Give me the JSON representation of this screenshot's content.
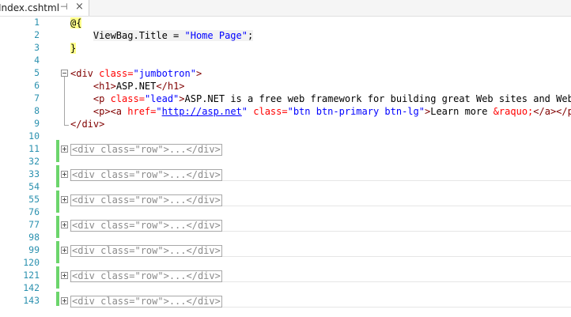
{
  "tab": {
    "title": "Index.cshtml",
    "pin_glyph": "⊣",
    "close_glyph": "×",
    "pin_icon": "pin-icon",
    "close_icon": "close-icon"
  },
  "gutter": {
    "line_numbers": [
      "1",
      "2",
      "3",
      "4",
      "5",
      "6",
      "7",
      "8",
      "9",
      "10",
      "11",
      "32",
      "33",
      "54",
      "55",
      "76",
      "77",
      "98",
      "99",
      "120",
      "121",
      "142",
      "143"
    ]
  },
  "code": {
    "razor_open": "@{",
    "viewbag_text": "ViewBag.Title = ",
    "viewbag_value": "\"Home Page\"",
    "viewbag_end": ";",
    "razor_close": "}",
    "div_open": "<div",
    "class_attr": " class=",
    "jumbotron_value": "\"jumbotron\"",
    "tag_close": ">",
    "h1_open": "<h1>",
    "h1_text": "ASP.NET",
    "h1_close": "</h1>",
    "p_open": "<p",
    "lead_value": "\"lead\"",
    "lead_text": "ASP.NET is a free web framework for building great Web sites and Web ap",
    "p_a_open": "<p><a",
    "href_attr": " href=",
    "quote": "\"",
    "href_link": "http://asp.net",
    "btn_value": "\"btn btn-primary btn-lg\"",
    "learn_more": "Learn more ",
    "raquo": "&raquo;",
    "a_p_close": "</a></p>",
    "div_close": "</div>",
    "collapsed_row": "<div class=\"row\">...</div>"
  },
  "colors": {
    "line_number": "#2b91af",
    "tag": "#800000",
    "attribute": "#ff0000",
    "string": "#0000ff",
    "razor_highlight": "#ffff8a",
    "change_bar": "#6cd56c"
  }
}
